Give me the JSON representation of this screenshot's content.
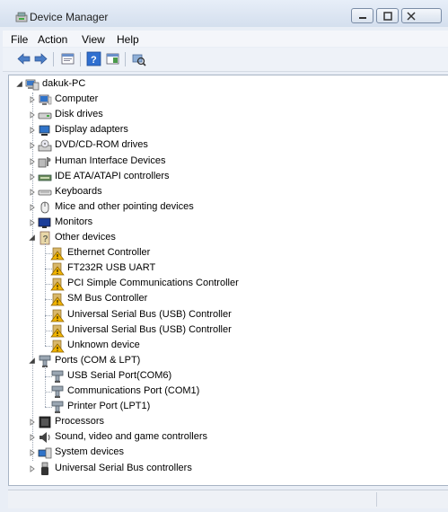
{
  "window": {
    "title": "Device Manager"
  },
  "menu": [
    "File",
    "Action",
    "View",
    "Help"
  ],
  "toolbar": [
    "back-icon",
    "forward-icon",
    "properties-icon",
    "help-icon",
    "show-hidden-icon",
    "scan-hardware-icon"
  ],
  "tree": {
    "root": "dakuk-PC",
    "items": [
      {
        "label": "Computer",
        "level": 1,
        "expander": "collapsed",
        "icon": "computer"
      },
      {
        "label": "Disk drives",
        "level": 1,
        "expander": "collapsed",
        "icon": "disk"
      },
      {
        "label": "Display adapters",
        "level": 1,
        "expander": "collapsed",
        "icon": "display"
      },
      {
        "label": "DVD/CD-ROM drives",
        "level": 1,
        "expander": "collapsed",
        "icon": "dvd"
      },
      {
        "label": "Human Interface Devices",
        "level": 1,
        "expander": "collapsed",
        "icon": "hid"
      },
      {
        "label": "IDE ATA/ATAPI controllers",
        "level": 1,
        "expander": "collapsed",
        "icon": "ide"
      },
      {
        "label": "Keyboards",
        "level": 1,
        "expander": "collapsed",
        "icon": "keyboard"
      },
      {
        "label": "Mice and other pointing devices",
        "level": 1,
        "expander": "collapsed",
        "icon": "mouse"
      },
      {
        "label": "Monitors",
        "level": 1,
        "expander": "collapsed",
        "icon": "monitor"
      },
      {
        "label": "Other devices",
        "level": 1,
        "expander": "expanded",
        "icon": "other"
      },
      {
        "label": "Ethernet Controller",
        "level": 2,
        "expander": "none",
        "icon": "warning"
      },
      {
        "label": "FT232R USB UART",
        "level": 2,
        "expander": "none",
        "icon": "warning"
      },
      {
        "label": "PCI Simple Communications Controller",
        "level": 2,
        "expander": "none",
        "icon": "warning"
      },
      {
        "label": "SM Bus Controller",
        "level": 2,
        "expander": "none",
        "icon": "warning"
      },
      {
        "label": "Universal Serial Bus (USB) Controller",
        "level": 2,
        "expander": "none",
        "icon": "warning"
      },
      {
        "label": "Universal Serial Bus (USB) Controller",
        "level": 2,
        "expander": "none",
        "icon": "warning"
      },
      {
        "label": "Unknown device",
        "level": 2,
        "expander": "none",
        "icon": "warning"
      },
      {
        "label": "Ports (COM & LPT)",
        "level": 1,
        "expander": "expanded",
        "icon": "port"
      },
      {
        "label": "USB Serial Port(COM6)",
        "level": 2,
        "expander": "none",
        "icon": "port"
      },
      {
        "label": "Communications Port (COM1)",
        "level": 2,
        "expander": "none",
        "icon": "port"
      },
      {
        "label": "Printer Port (LPT1)",
        "level": 2,
        "expander": "none",
        "icon": "port"
      },
      {
        "label": "Processors",
        "level": 1,
        "expander": "collapsed",
        "icon": "processor"
      },
      {
        "label": "Sound, video and game controllers",
        "level": 1,
        "expander": "collapsed",
        "icon": "sound"
      },
      {
        "label": "System devices",
        "level": 1,
        "expander": "collapsed",
        "icon": "system"
      },
      {
        "label": "Universal Serial Bus controllers",
        "level": 1,
        "expander": "collapsed",
        "icon": "usb"
      }
    ]
  },
  "colors": {
    "warning": "#f0b400",
    "selection": "#3399ff",
    "window_frame": "#dce6f4"
  }
}
